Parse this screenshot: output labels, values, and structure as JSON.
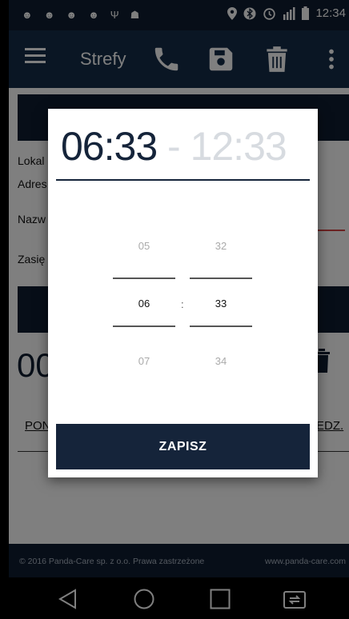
{
  "status_bar": {
    "time": "12:34"
  },
  "app_bar": {
    "title": "Strefy"
  },
  "form": {
    "lokal_label": "Lokal",
    "adres_label": "Adres",
    "nazwa_label": "Nazw",
    "zasieg_label": "Zasię",
    "time_partial": "00",
    "tab_left": "PON",
    "tab_right": "EDZ."
  },
  "time_dialog": {
    "start_time": "06:33",
    "separator": " - ",
    "end_time": "12:33",
    "hours": [
      "05",
      "06",
      "07"
    ],
    "minutes": [
      "32",
      "33",
      "34"
    ],
    "colon": ":",
    "save_label": "ZAPISZ"
  },
  "footer": {
    "copyright": "© 2016 Panda-Care sp. z o.o. Prawa zastrzeżone",
    "website": "www.panda-care.com"
  },
  "icons": {
    "menu": "hamburger-icon",
    "phone": "phone-icon",
    "save": "floppy-disk-icon",
    "delete": "trash-icon",
    "more": "more-vert-icon"
  },
  "colors": {
    "primary": "#152c48",
    "dark": "#0f1d30",
    "accent_red": "#d64545"
  }
}
